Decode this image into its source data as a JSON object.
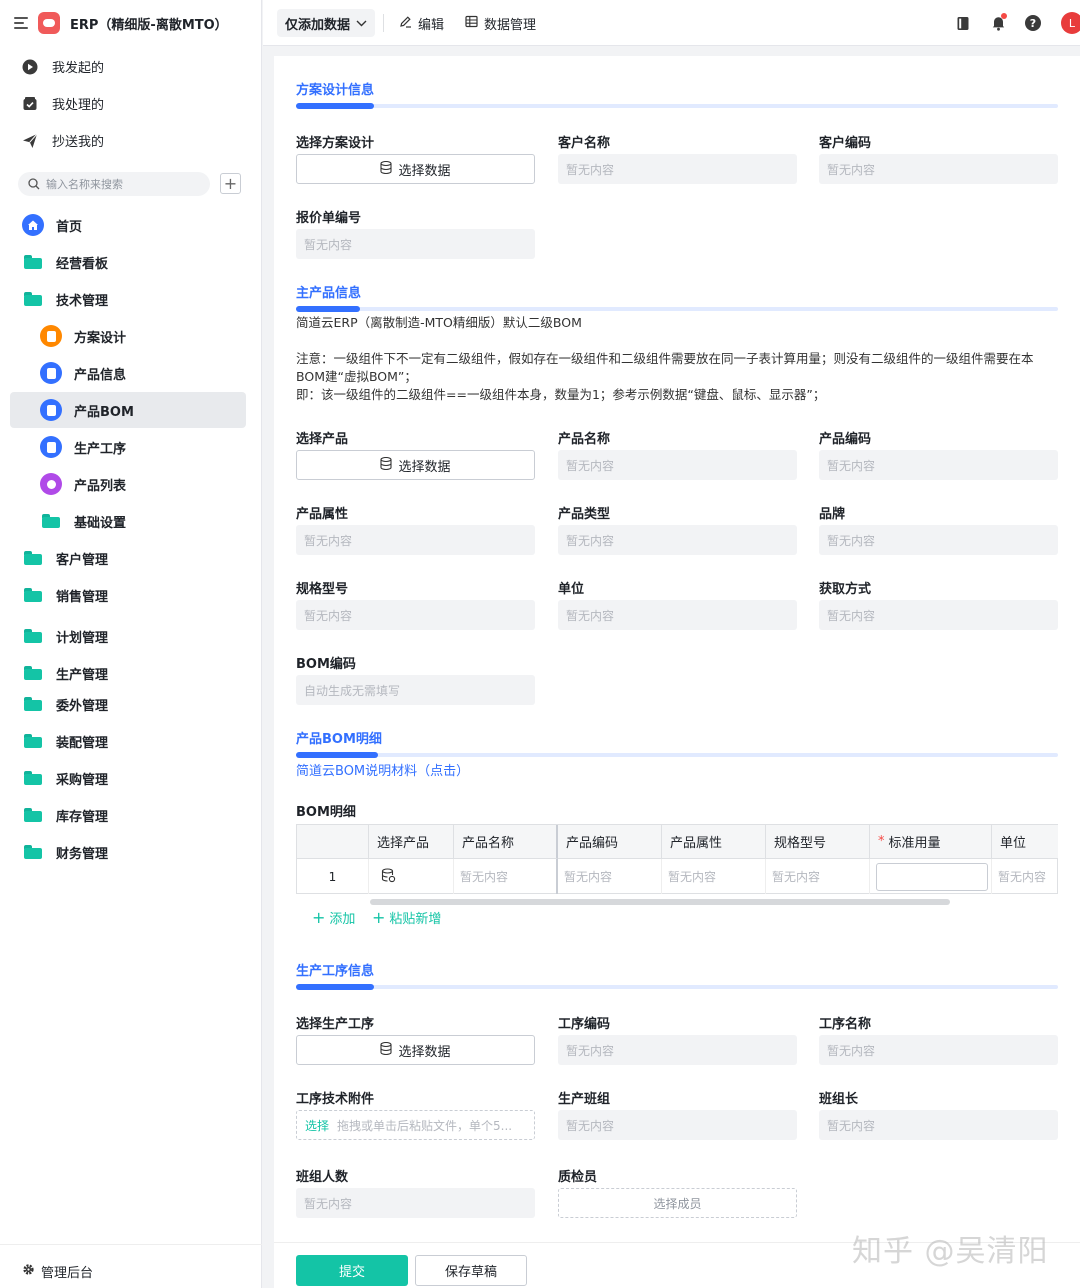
{
  "app": {
    "title": "ERP（精细版-离散MTO）",
    "brand_color": "#f05a5a",
    "accent_color": "#3370ff",
    "action_color": "#14c4a6"
  },
  "quick": [
    {
      "label": "我发起的",
      "icon": "play-circle-icon"
    },
    {
      "label": "我处理的",
      "icon": "inbox-check-icon"
    },
    {
      "label": "抄送我的",
      "icon": "send-icon"
    }
  ],
  "search": {
    "placeholder": "输入名称来搜索"
  },
  "nav": [
    {
      "label": "首页",
      "icon": "home-icon"
    },
    {
      "label": "经营看板",
      "icon": "folder-icon"
    },
    {
      "label": "技术管理",
      "icon": "folder-open-icon"
    },
    {
      "label": "方案设计",
      "icon": "form-icon",
      "color": "#ff8800"
    },
    {
      "label": "产品信息",
      "icon": "form-icon",
      "color": "#3370ff"
    },
    {
      "label": "产品BOM",
      "icon": "form-icon",
      "color": "#3370ff",
      "active": true
    },
    {
      "label": "生产工序",
      "icon": "form-icon",
      "color": "#3370ff"
    },
    {
      "label": "产品列表",
      "icon": "report-icon",
      "color": "#b04ae8"
    },
    {
      "label": "基础设置",
      "icon": "folder-icon"
    },
    {
      "label": "客户管理",
      "icon": "folder-icon"
    },
    {
      "label": "销售管理",
      "icon": "folder-icon"
    },
    {
      "label": "计划管理",
      "icon": "folder-icon"
    },
    {
      "label": "生产管理",
      "icon": "folder-icon"
    },
    {
      "label": "委外管理",
      "icon": "folder-icon"
    },
    {
      "label": "装配管理",
      "icon": "folder-icon"
    },
    {
      "label": "采购管理",
      "icon": "folder-icon"
    },
    {
      "label": "库存管理",
      "icon": "folder-icon"
    },
    {
      "label": "财务管理",
      "icon": "folder-icon"
    }
  ],
  "admin": {
    "label": "管理后台"
  },
  "toolbar": {
    "mode": "仅添加数据",
    "edit": "编辑",
    "data_manage": "数据管理",
    "avatar": "L"
  },
  "common": {
    "empty": "暂无内容",
    "select_data": "选择数据"
  },
  "sec1": {
    "title": "方案设计信息",
    "select_plan": "选择方案设计",
    "customer_name": "客户名称",
    "customer_code": "客户编码",
    "quote_no": "报价单编号"
  },
  "sec2": {
    "title": "主产品信息",
    "desc1": "简道云ERP（离散制造-MTO精细版）默认二级BOM",
    "desc2": "注意：一级组件下不一定有二级组件，假如存在一级组件和二级组件需要放在同一子表计算用量；则没有二级组件的一级组件需要在本BOM建“虚拟BOM”；",
    "desc3": "即：该一级组件的二级组件==一级组件本身，数量为1；参考示例数据“键盘、鼠标、显示器”；",
    "select_product": "选择产品",
    "product_name": "产品名称",
    "product_code": "产品编码",
    "product_attr": "产品属性",
    "product_type": "产品类型",
    "brand": "品牌",
    "spec": "规格型号",
    "unit": "单位",
    "acquire": "获取方式",
    "bom_code": "BOM编码",
    "bom_code_placeholder": "自动生成无需填写"
  },
  "sec3": {
    "title": "产品BOM明细",
    "doc_link": "简道云BOM说明材料（点击）",
    "table_label": "BOM明细",
    "columns": [
      "选择产品",
      "产品名称",
      "产品编码",
      "产品属性",
      "规格型号",
      "标准用量",
      "单位"
    ],
    "rows": [
      {
        "index": "1"
      }
    ],
    "add": "添加",
    "paste_add": "粘贴新增"
  },
  "sec4": {
    "title": "生产工序信息",
    "select_process": "选择生产工序",
    "process_code": "工序编码",
    "process_name": "工序名称",
    "attachment": "工序技术附件",
    "attach_pick": "选择",
    "attach_hint": "拖拽或单击后粘贴文件，单个5...",
    "team": "生产班组",
    "leader": "班组长",
    "headcount": "班组人数",
    "inspector": "质检员",
    "select_member": "选择成员"
  },
  "footer": {
    "submit": "提交",
    "draft": "保存草稿"
  },
  "watermark": "知乎 @吴清阳"
}
